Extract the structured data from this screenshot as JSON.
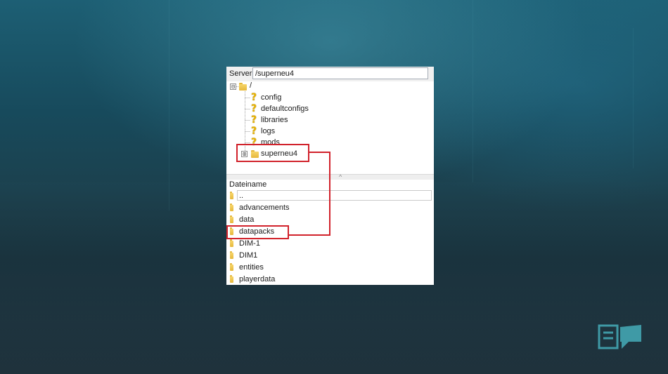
{
  "server": {
    "label": "Server:",
    "path": "/superneu4"
  },
  "tree": {
    "root": {
      "expander": "⊟",
      "label": "/"
    },
    "children": [
      {
        "label": "config",
        "icon": "question-icon"
      },
      {
        "label": "defaultconfigs",
        "icon": "question-icon"
      },
      {
        "label": "libraries",
        "icon": "question-icon"
      },
      {
        "label": "logs",
        "icon": "question-icon"
      },
      {
        "label": "mods",
        "icon": "question-icon"
      },
      {
        "label": "superneu4",
        "icon": "folder-icon",
        "expander": "⊞",
        "highlighted": true
      }
    ]
  },
  "list": {
    "column_header": "Dateiname",
    "sort_indicator": "^",
    "rows": [
      {
        "label": "..",
        "icon": "folder-icon"
      },
      {
        "label": "advancements",
        "icon": "folder-icon"
      },
      {
        "label": "data",
        "icon": "folder-icon"
      },
      {
        "label": "datapacks",
        "icon": "folder-icon",
        "highlighted": true
      },
      {
        "label": "DIM-1",
        "icon": "folder-icon"
      },
      {
        "label": "DIM1",
        "icon": "folder-icon"
      },
      {
        "label": "entities",
        "icon": "folder-icon"
      },
      {
        "label": "playerdata",
        "icon": "folder-icon"
      }
    ]
  },
  "colors": {
    "highlight": "#d1222b",
    "background_top": "#1d5f74",
    "background_bottom": "#1f323c",
    "logo": "#3f9aa6"
  }
}
